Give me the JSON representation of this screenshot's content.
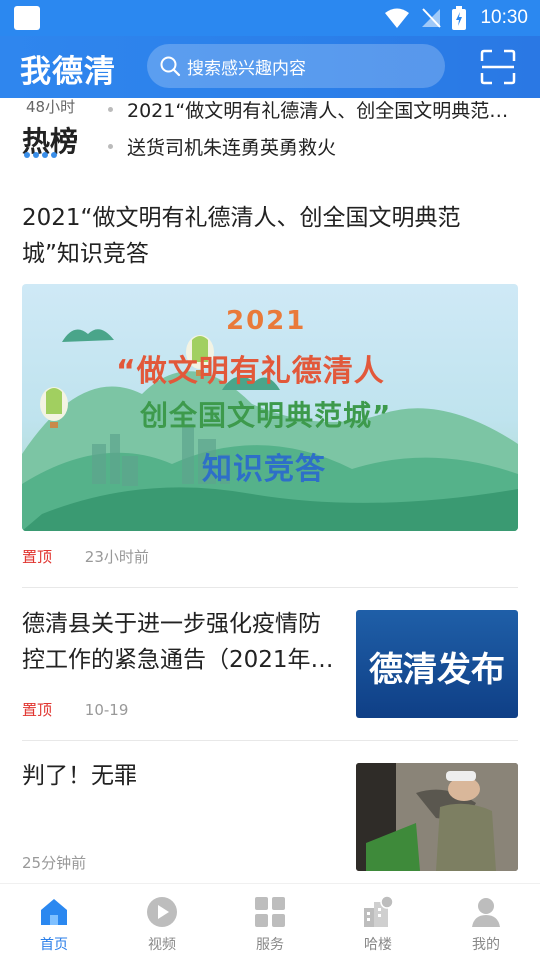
{
  "status_bar": {
    "time": "10:30"
  },
  "header": {
    "logo": "我德清",
    "search_placeholder": "搜索感兴趣内容"
  },
  "hot": {
    "time_label": "48小时",
    "title": "热榜",
    "items": [
      "2021“做文明有礼德清人、创全国文明典范城”知识竞答",
      "送货司机朱连勇英勇救火"
    ]
  },
  "articles": [
    {
      "title": "2021“做文明有礼德清人、创全国文明典范城”知识竞答",
      "banner": {
        "year": "2021",
        "line1": "“做文明有礼德清人",
        "line2": "创全国文明典范城”",
        "line3": "知识竞答"
      },
      "badge": "置顶",
      "time": "23小时前"
    },
    {
      "title": "德清县关于进一步强化疫情防控工作的紧急通告（2021年…",
      "thumb_text": "德清发布",
      "badge": "置顶",
      "time": "10-19"
    },
    {
      "title": "判了！无罪",
      "time": "25分钟前"
    }
  ],
  "bottom_nav": [
    {
      "label": "首页",
      "icon": "home-icon",
      "active": true
    },
    {
      "label": "视频",
      "icon": "video-icon",
      "active": false
    },
    {
      "label": "服务",
      "icon": "grid-icon",
      "active": false
    },
    {
      "label": "哈楼",
      "icon": "building-icon",
      "active": false
    },
    {
      "label": "我的",
      "icon": "profile-icon",
      "active": false
    }
  ],
  "colors": {
    "accent": "#2b7fe9",
    "pin": "#e0342f"
  }
}
